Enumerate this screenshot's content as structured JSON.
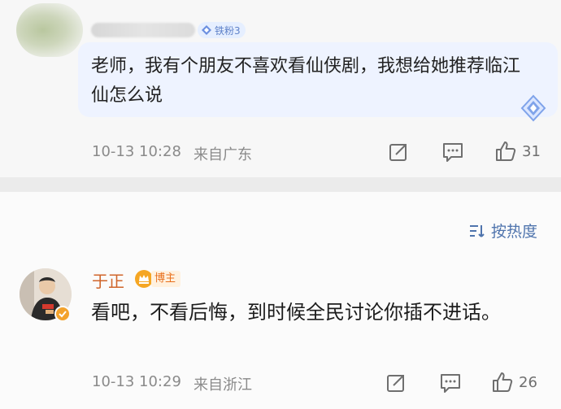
{
  "first_comment": {
    "fan_badge": "铁粉3",
    "text": "老师，我有个朋友不喜欢看仙侠剧，我想给她推荐临江仙怎么说",
    "timestamp": "10-13 10:28",
    "location": "来自广东",
    "like_count": "31"
  },
  "sort": {
    "label": "按热度"
  },
  "reply": {
    "author": "于正",
    "badge": "博主",
    "text": "看吧，不看后悔，到时候全民讨论你插不进话。",
    "timestamp": "10-13 10:29",
    "location": "来自浙江",
    "like_count": "26"
  },
  "colors": {
    "author_name": "#d0652b",
    "sort_link": "#4f74ad",
    "bubble": "#eef3ff"
  }
}
